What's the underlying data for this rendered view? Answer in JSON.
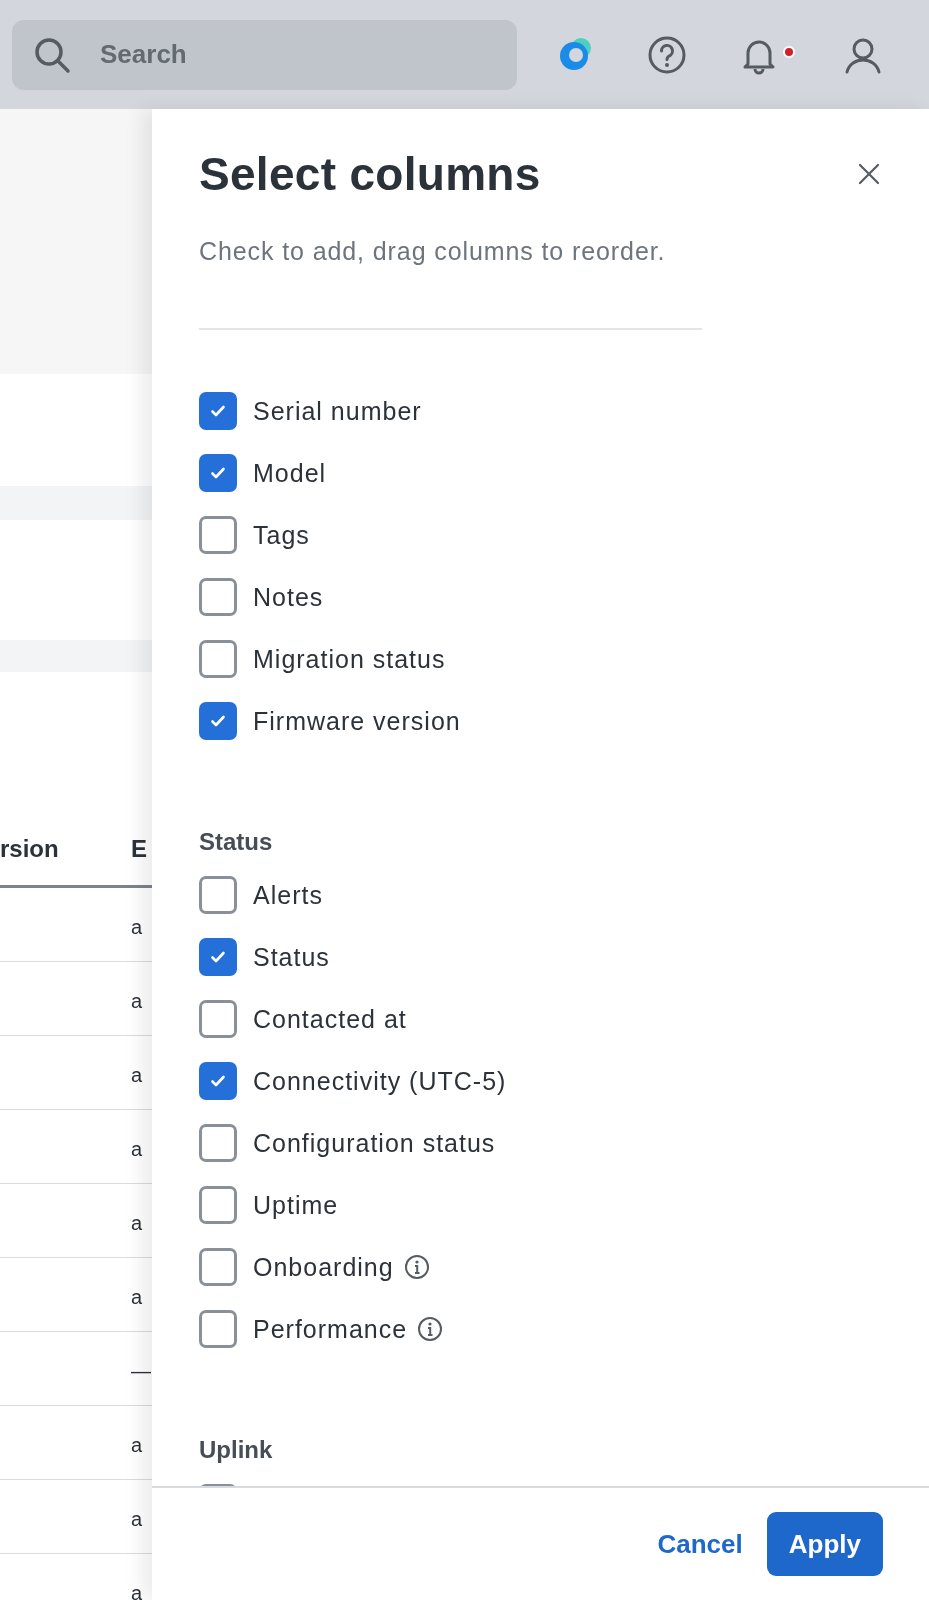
{
  "topbar": {
    "search": {
      "placeholder": "Search"
    },
    "notifications": {
      "unread": true
    }
  },
  "background_table": {
    "columns": [
      "rsion",
      "E"
    ],
    "rows": [
      [
        "",
        "a"
      ],
      [
        "",
        "a"
      ],
      [
        "",
        "a"
      ],
      [
        "",
        "a"
      ],
      [
        "",
        "a"
      ],
      [
        "",
        "a"
      ],
      [
        "",
        "—"
      ],
      [
        "",
        "a"
      ],
      [
        "",
        "a"
      ],
      [
        "",
        "a"
      ]
    ]
  },
  "panel": {
    "title": "Select columns",
    "subtitle": "Check to add, drag columns to reorder.",
    "groups": [
      {
        "items": [
          {
            "label": "Serial number",
            "checked": true,
            "info": false
          },
          {
            "label": "Model",
            "checked": true,
            "info": false
          },
          {
            "label": "Tags",
            "checked": false,
            "info": false
          },
          {
            "label": "Notes",
            "checked": false,
            "info": false
          },
          {
            "label": "Migration status",
            "checked": false,
            "info": false
          },
          {
            "label": "Firmware version",
            "checked": true,
            "info": false
          }
        ]
      },
      {
        "heading": "Status",
        "items": [
          {
            "label": "Alerts",
            "checked": false,
            "info": false
          },
          {
            "label": "Status",
            "checked": true,
            "info": false
          },
          {
            "label": "Contacted at",
            "checked": false,
            "info": false
          },
          {
            "label": "Connectivity (UTC-5)",
            "checked": true,
            "info": false
          },
          {
            "label": "Configuration status",
            "checked": false,
            "info": false
          },
          {
            "label": "Uptime",
            "checked": false,
            "info": false
          },
          {
            "label": "Onboarding",
            "checked": false,
            "info": true
          },
          {
            "label": "Performance",
            "checked": false,
            "info": true
          }
        ]
      },
      {
        "heading": "Uplink",
        "items": [
          {
            "checked": false,
            "info": false
          }
        ]
      }
    ],
    "buttons": [
      {
        "label": "Cancel",
        "kind": "link"
      },
      {
        "label": "Apply",
        "kind": "primary"
      }
    ]
  }
}
